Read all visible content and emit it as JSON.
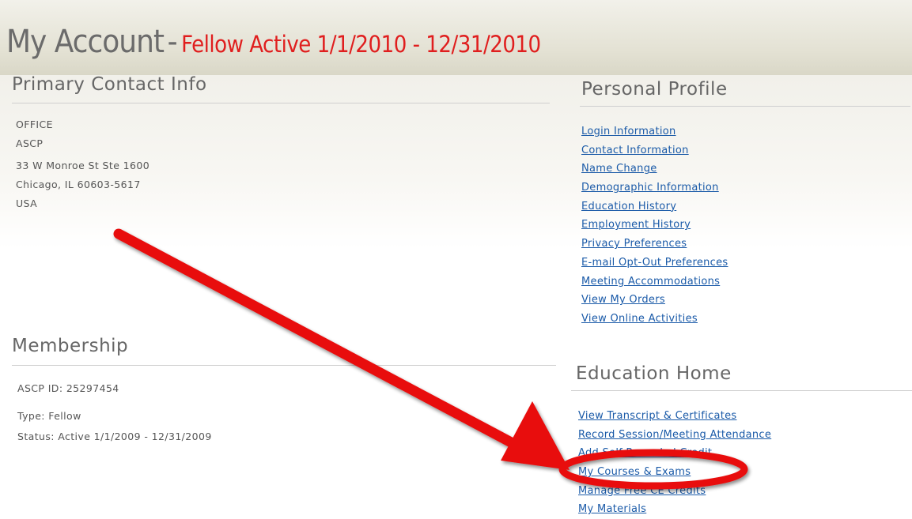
{
  "header": {
    "title": "My Account",
    "separator": "-",
    "status": "Fellow Active 1/1/2010 - 12/31/2010"
  },
  "primary_contact": {
    "heading": "Primary Contact Info",
    "lines": [
      "OFFICE",
      "ASCP",
      "33 W Monroe St Ste 1600",
      "Chicago, IL 60603-5617",
      "USA"
    ]
  },
  "membership": {
    "heading": "Membership",
    "id": "ASCP ID: 25297454",
    "type": "Type: Fellow",
    "status": "Status:  Active 1/1/2009 - 12/31/2009"
  },
  "personal_profile": {
    "heading": "Personal Profile",
    "links": [
      "Login Information",
      "Contact Information",
      "Name Change",
      "Demographic Information",
      "Education History",
      "Employment History",
      "Privacy Preferences",
      "E-mail Opt-Out Preferences",
      "Meeting Accommodations",
      "View My Orders",
      "View Online Activities"
    ]
  },
  "education_home": {
    "heading": "Education Home",
    "links": [
      "View Transcript & Certificates",
      "Record Session/Meeting Attendance",
      "Add Self-Recorded Credit",
      "My Courses & Exams",
      "Manage Free CE Credits",
      "My Materials"
    ]
  },
  "annotation": {
    "color": "#e8100f",
    "highlighted_link": "My Courses & Exams"
  }
}
